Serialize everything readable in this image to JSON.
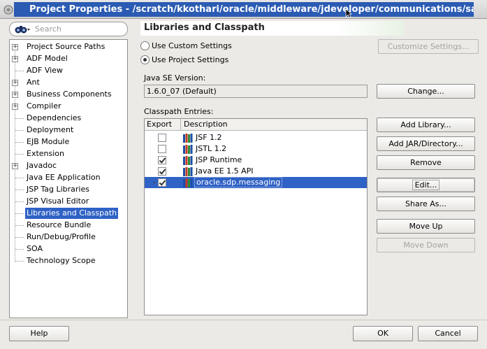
{
  "window": {
    "title": "Project Properties - /scratch/kkothari/oracle/middleware/jdeveloper/communications/samples/usermes"
  },
  "search": {
    "placeholder": "Search"
  },
  "tree": {
    "items": [
      {
        "label": "Project Source Paths",
        "expandable": true
      },
      {
        "label": "ADF Model",
        "expandable": true
      },
      {
        "label": "ADF View",
        "expandable": false
      },
      {
        "label": "Ant",
        "expandable": true
      },
      {
        "label": "Business Components",
        "expandable": true
      },
      {
        "label": "Compiler",
        "expandable": true
      },
      {
        "label": "Dependencies",
        "expandable": false
      },
      {
        "label": "Deployment",
        "expandable": false
      },
      {
        "label": "EJB Module",
        "expandable": false
      },
      {
        "label": "Extension",
        "expandable": false
      },
      {
        "label": "Javadoc",
        "expandable": true
      },
      {
        "label": "Java EE Application",
        "expandable": false
      },
      {
        "label": "JSP Tag Libraries",
        "expandable": false
      },
      {
        "label": "JSP Visual Editor",
        "expandable": false
      },
      {
        "label": "Libraries and Classpath",
        "expandable": false,
        "selected": true
      },
      {
        "label": "Resource Bundle",
        "expandable": false
      },
      {
        "label": "Run/Debug/Profile",
        "expandable": false
      },
      {
        "label": "SOA",
        "expandable": false
      },
      {
        "label": "Technology Scope",
        "expandable": false
      }
    ]
  },
  "panel": {
    "title": "Libraries and Classpath",
    "radio_custom": "Use Custom Settings",
    "radio_project": "Use Project Settings",
    "customize_button": "Customize Settings...",
    "java_se_label": "Java SE Version:",
    "java_se_value": "1.6.0_07 (Default)",
    "change_button": "Change...",
    "classpath_label": "Classpath Entries:",
    "columns": {
      "export": "Export",
      "description": "Description"
    },
    "entries": [
      {
        "export": false,
        "description": "JSF 1.2"
      },
      {
        "export": false,
        "description": "JSTL 1.2"
      },
      {
        "export": true,
        "description": "JSP Runtime"
      },
      {
        "export": true,
        "description": "Java EE 1.5 API"
      },
      {
        "export": true,
        "description": "oracle.sdp.messaging",
        "selected": true
      }
    ],
    "buttons": {
      "add_library": "Add Library...",
      "add_jar": "Add JAR/Directory...",
      "remove": "Remove",
      "edit": "Edit...",
      "share_as": "Share As...",
      "move_up": "Move Up",
      "move_down": "Move Down"
    }
  },
  "footer": {
    "help": "Help",
    "ok": "OK",
    "cancel": "Cancel"
  },
  "colors": {
    "selection": "#2f62c5",
    "title_bar": "#2b5bb3"
  }
}
